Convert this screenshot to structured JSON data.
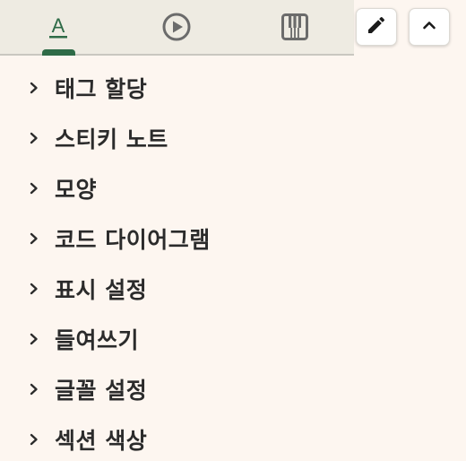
{
  "toolbar": {
    "tabs": [
      {
        "icon": "text-format-icon",
        "label": "A",
        "active": true
      },
      {
        "icon": "play-icon",
        "active": false
      },
      {
        "icon": "piano-icon",
        "active": false
      }
    ],
    "buttons": [
      {
        "icon": "pencil-icon"
      },
      {
        "icon": "chevron-up-icon"
      }
    ]
  },
  "sections": [
    {
      "label": "태그 할당"
    },
    {
      "label": "스티키 노트"
    },
    {
      "label": "모양"
    },
    {
      "label": "코드 다이어그램"
    },
    {
      "label": "표시 설정"
    },
    {
      "label": "들여쓰기"
    },
    {
      "label": "글꼴 설정"
    },
    {
      "label": "섹션 색상"
    }
  ],
  "colors": {
    "background": "#fdf6f0",
    "tabbar_background": "#eeebe2",
    "accent": "#2e6b47",
    "icon_inactive": "#6b6b6b",
    "text": "#2b2b2b"
  }
}
